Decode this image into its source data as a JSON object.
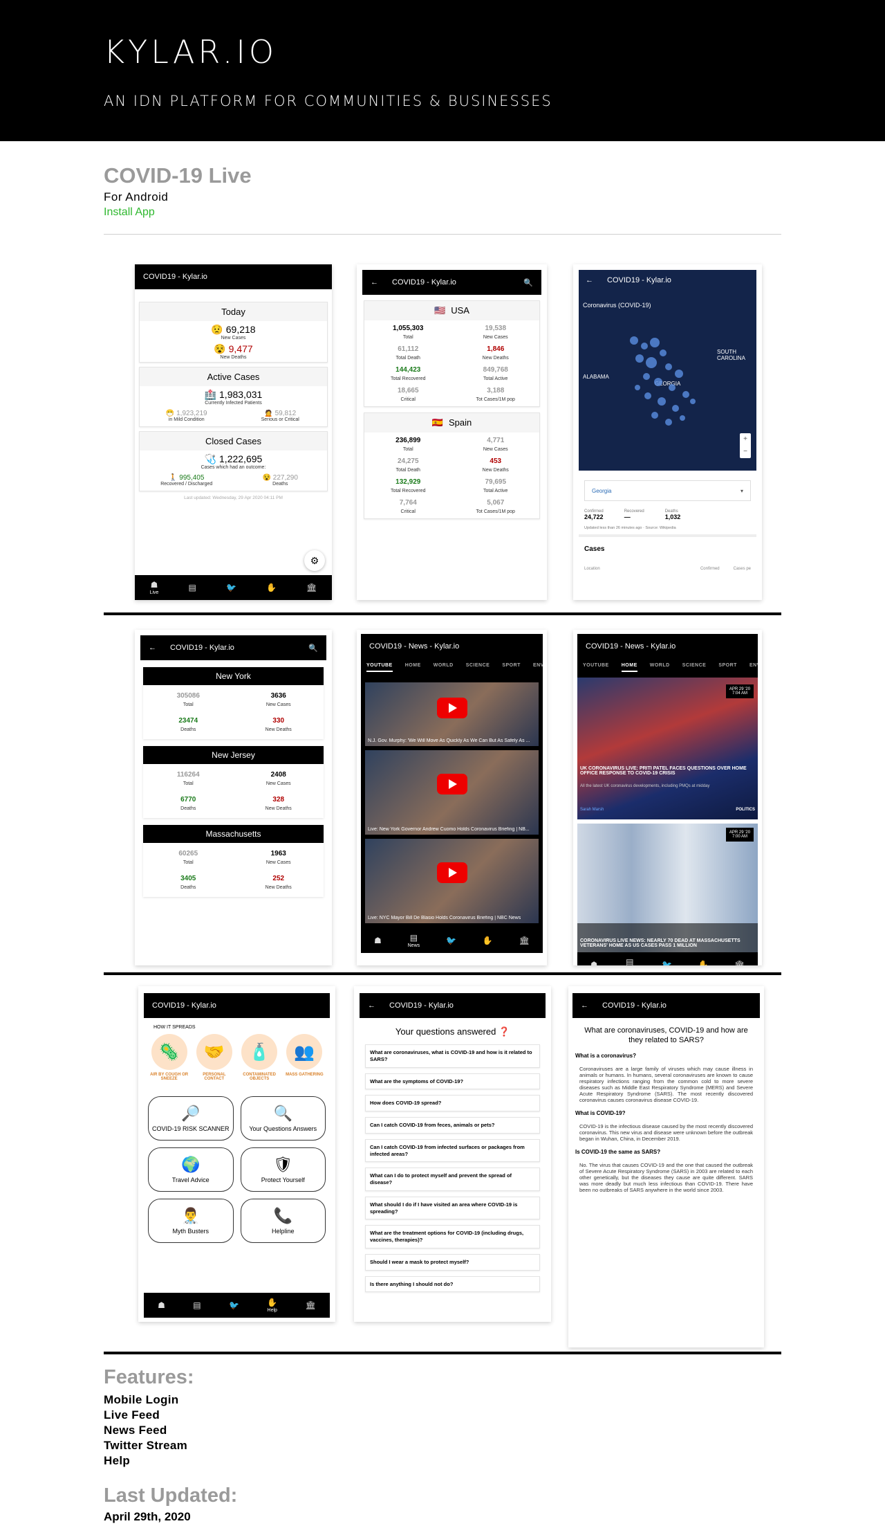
{
  "header": {
    "brand": "KYLAR.IO",
    "tagline": "AN IDN PLATFORM FOR COMMUNITIES & BUSINESSES"
  },
  "app": {
    "title": "COVID-19 Live",
    "platform": "For Android",
    "install": "Install App"
  },
  "common": {
    "title": "COVID19 - Kylar.io",
    "news_title": "COVID19 - News - Kylar.io",
    "nav_live": "Live",
    "nav_news": "News",
    "nav_help": "Help"
  },
  "s1": {
    "today": "Today",
    "new_cases": "69,218",
    "new_cases_l": "New Cases",
    "new_deaths": "9,477",
    "new_deaths_l": "New Deaths",
    "active": "Active Cases",
    "infected": "1,983,031",
    "infected_l": "Currently Infected Patients",
    "mild": "1,923,219",
    "mild_l": "in Mild Condition",
    "serious": "59,812",
    "serious_l": "Serious or Critical",
    "closed": "Closed Cases",
    "outcome": "1,222,695",
    "outcome_l": "Cases which had an outcome:",
    "recovered": "995,405",
    "recovered_l": "Recovered / Discharged",
    "deaths": "227,290",
    "deaths_l": "Deaths",
    "updated": "Last updated: Wednesday, 29 Apr 2020 04:11 PM"
  },
  "s2": {
    "countries": [
      {
        "name": "USA",
        "cells": [
          [
            "1,055,303",
            "Total"
          ],
          [
            "19,538",
            "New Cases"
          ],
          [
            "61,112",
            "Total Death"
          ],
          [
            "1,846",
            "New Deaths"
          ],
          [
            "144,423",
            "Total Recovered"
          ],
          [
            "849,768",
            "Total Active"
          ],
          [
            "18,665",
            "Critical"
          ],
          [
            "3,188",
            "Tot Cases/1M pop"
          ]
        ]
      },
      {
        "name": "Spain",
        "cells": [
          [
            "236,899",
            "Total"
          ],
          [
            "4,771",
            "New Cases"
          ],
          [
            "24,275",
            "Total Death"
          ],
          [
            "453",
            "New Deaths"
          ],
          [
            "132,929",
            "Total Recovered"
          ],
          [
            "79,695",
            "Total Active"
          ],
          [
            "7,764",
            "Critical"
          ],
          [
            "5,067",
            "Tot Cases/1M pop"
          ]
        ]
      }
    ]
  },
  "s3": {
    "map_title": "Coronavirus (COVID-19)",
    "alabama": "ALABAMA",
    "georgia": "GEORGIA",
    "carolina": "SOUTH CAROLINA",
    "select": "Georgia",
    "confirmed_l": "Confirmed",
    "confirmed": "24,722",
    "recovered_l": "Recovered",
    "recovered": "—",
    "deaths_l": "Deaths",
    "deaths": "1,032",
    "note": "Updated less than 26 minutes ago · Source: Wikipedia",
    "cases": "Cases",
    "location": "Location",
    "confirmed_col": "Confirmed",
    "cases_col": "Cases pe"
  },
  "s4": {
    "states": [
      {
        "name": "New York",
        "cells": [
          [
            "305086",
            "Total"
          ],
          [
            "3636",
            "New Cases"
          ],
          [
            "23474",
            "Deaths"
          ],
          [
            "330",
            "New Deaths"
          ]
        ]
      },
      {
        "name": "New Jersey",
        "cells": [
          [
            "116264",
            "Total"
          ],
          [
            "2408",
            "New Cases"
          ],
          [
            "6770",
            "Deaths"
          ],
          [
            "328",
            "New Deaths"
          ]
        ]
      },
      {
        "name": "Massachusetts",
        "cells": [
          [
            "60265",
            "Total"
          ],
          [
            "1963",
            "New Cases"
          ],
          [
            "3405",
            "Deaths"
          ],
          [
            "252",
            "New Deaths"
          ]
        ]
      }
    ]
  },
  "s5": {
    "tabs": [
      "YOUTUBE",
      "HOME",
      "WORLD",
      "SCIENCE",
      "SPORT",
      "ENVI"
    ],
    "videos": [
      "N.J. Gov. Murphy: 'We Will Move As Quickly As We Can But As Safely As ...",
      "Live: New York Governor Andrew Cuomo Holds Coronavirus Briefing | NB...",
      "Live: NYC Mayor Bill De Blasio Holds Coronavirus Briefing | NBC News"
    ]
  },
  "s6": {
    "tabs": [
      "YOUTUBE",
      "HOME",
      "WORLD",
      "SCIENCE",
      "SPORT",
      "ENV"
    ],
    "date1": "APR 29 '20 7:04 AM",
    "head1": "UK CORONAVIRUS LIVE: PRITI PATEL FACES QUESTIONS OVER HOME OFFICE RESPONSE TO COVID-19 CRISIS",
    "sub1": "All the latest UK coronavirus developments, including PMQs at midday",
    "author": "Sarah Marsh",
    "section": "POLITICS",
    "date2": "APR 29 '20 7:00 AM",
    "head2": "CORONAVIRUS LIVE NEWS: NEARLY 70 DEAD AT MASSACHUSETTS VETERANS' HOME AS US CASES PASS 1 MILLION"
  },
  "s7": {
    "how": "HOW IT SPREADS",
    "spread": [
      "AIR BY COUGH OR SNEEZE",
      "PERSONAL CONTACT",
      "CONTAMINATED OBJECTS",
      "MASS GATHERING"
    ],
    "tiles": [
      "COVID-19 RISK SCANNER",
      "Your Questions Answers",
      "Travel Advice",
      "Protect Yourself",
      "Myth Busters",
      "Helpline"
    ]
  },
  "s8": {
    "heading": "Your questions answered ❓",
    "questions": [
      "What are coronaviruses, what is COVID-19 and how is it related to SARS?",
      "What are the symptoms of COVID-19?",
      "How does COVID-19 spread?",
      "Can I catch COVID-19 from feces, animals or pets?",
      "Can I catch COVID-19 from infected surfaces or packages from infected areas?",
      "What can I do to protect myself and prevent the spread of disease?",
      "What should I do if I have visited an area where COVID-19 is spreading?",
      "What are the treatment options for COVID-19 (including drugs, vaccines, therapies)?",
      "Should I wear a mask to protect myself?",
      "Is there anything I should not do?"
    ]
  },
  "s9": {
    "heading": "What are coronaviruses, COVID-19 and how are they related to SARS?",
    "sections": [
      {
        "q": "What is a coronavirus?",
        "a": "Coronaviruses are a large family of viruses which may cause illness in animals or humans. In humans, several coronaviruses are known to cause respiratory infections ranging from the common cold to more severe diseases such as Middle East Respiratory Syndrome (MERS) and Severe Acute Respiratory Syndrome (SARS). The most recently discovered coronavirus causes coronavirus disease COVID-19."
      },
      {
        "q": "What is COVID-19?",
        "a": "COVID-19 is the infectious disease caused by the most recently discovered coronavirus. This new virus and disease were unknown before the outbreak began in Wuhan, China, in December 2019."
      },
      {
        "q": "Is COVID-19 the same as SARS?",
        "a": "No. The virus that causes COVID-19 and the one that caused the outbreak of Severe Acute Respiratory Syndrome (SARS) in 2003 are related to each other genetically, but the diseases they cause are quite different. SARS was more deadly but much less infectious than COVID-19. There have been no outbreaks of SARS anywhere in the world since 2003."
      }
    ]
  },
  "features": {
    "heading": "Features:",
    "items": [
      "Mobile Login",
      "Live Feed",
      "News Feed",
      "Twitter Stream",
      "Help"
    ]
  },
  "updated": {
    "heading": "Last Updated:",
    "date": "April 29th, 2020"
  }
}
